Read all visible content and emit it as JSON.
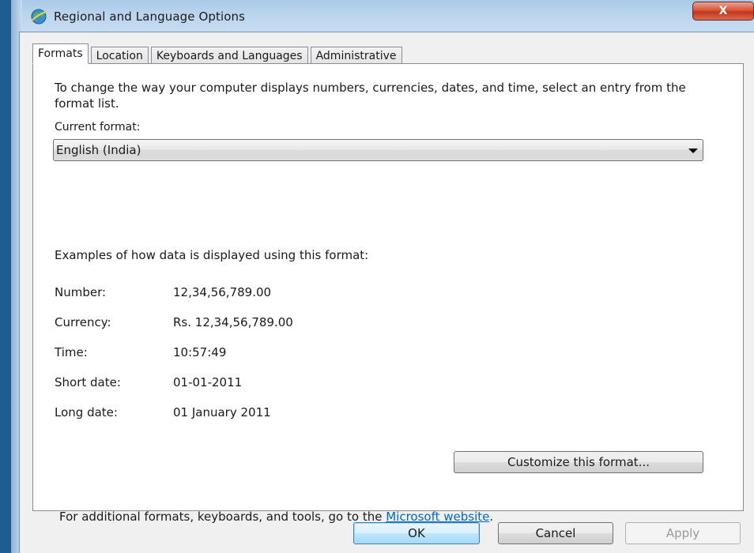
{
  "window": {
    "title": "Regional and Language Options",
    "close_label": "X"
  },
  "tabs": [
    {
      "label": "Formats",
      "selected": true
    },
    {
      "label": "Location",
      "selected": false
    },
    {
      "label": "Keyboards and Languages",
      "selected": false
    },
    {
      "label": "Administrative",
      "selected": false
    }
  ],
  "formats": {
    "intro": "To change the way your computer displays numbers, currencies, dates, and time, select an entry from the format list.",
    "current_format_label": "Current format:",
    "current_format_value": "English (India)",
    "examples_label": "Examples of how data is displayed using this format:",
    "examples": [
      {
        "label": "Number:",
        "value": "12,34,56,789.00"
      },
      {
        "label": "Currency:",
        "value": "Rs. 12,34,56,789.00"
      },
      {
        "label": "Time:",
        "value": "10:57:49"
      },
      {
        "label": "Short date:",
        "value": "01-01-2011"
      },
      {
        "label": "Long date:",
        "value": "01 January 2011"
      }
    ],
    "customize_button": "Customize this format...",
    "footer_prefix": "For additional formats, keyboards, and tools, go to the ",
    "footer_link": "Microsoft website",
    "footer_suffix": "."
  },
  "buttons": {
    "ok": "OK",
    "cancel": "Cancel",
    "apply": "Apply"
  },
  "colors": {
    "link": "#0066cc",
    "close_button": "#c2381d",
    "default_button_border": "#3c7fb1"
  },
  "icons": {
    "window_icon": "globe-icon",
    "dropdown": "chevron-down-icon"
  }
}
